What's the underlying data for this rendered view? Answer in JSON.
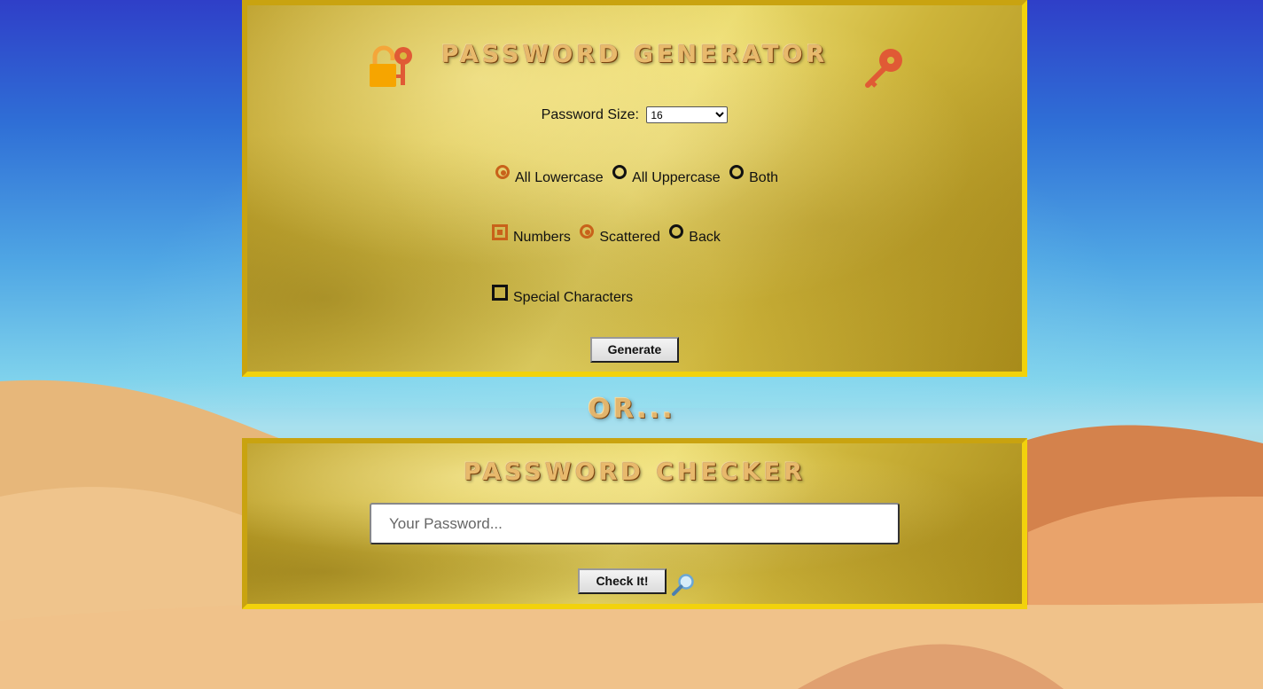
{
  "generator": {
    "title": "PASSWORD GENERATOR",
    "size_label": "Password Size:",
    "size_value": "16",
    "case_options": [
      {
        "label": "All Lowercase",
        "selected": true
      },
      {
        "label": "All Uppercase",
        "selected": false
      },
      {
        "label": "Both",
        "selected": false
      }
    ],
    "numbers": {
      "label": "Numbers",
      "checked": true
    },
    "number_position": [
      {
        "label": "Scattered",
        "selected": true
      },
      {
        "label": "Back",
        "selected": false
      }
    ],
    "special": {
      "label": "Special Characters",
      "checked": false
    },
    "generate_label": "Generate",
    "icons": [
      "lock-icon",
      "key-icon"
    ]
  },
  "or_text": "OR...",
  "checker": {
    "title": "PASSWORD CHECKER",
    "input_placeholder": "Your Password...",
    "check_label": "Check It!",
    "icon": "magnifier-icon"
  },
  "colors": {
    "accent": "#c8621a",
    "gold_border_dark": "#c9a310",
    "gold_border_light": "#f2d20c",
    "title_text": "#e8b96c"
  }
}
